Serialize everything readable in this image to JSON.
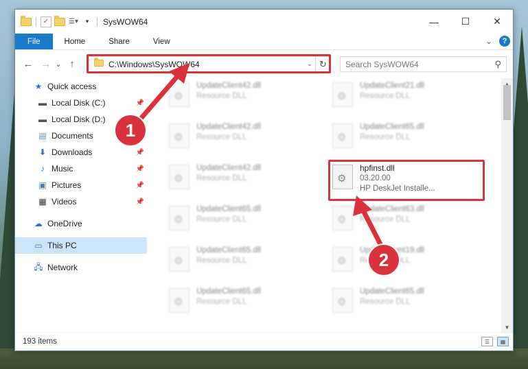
{
  "window": {
    "title": "SysWOW64",
    "minimize": "—",
    "maximize": "☐",
    "close": "✕"
  },
  "ribbon": {
    "tabs": [
      "File",
      "Home",
      "Share",
      "View"
    ],
    "collapse": "⌄",
    "help": "?"
  },
  "address": {
    "back": "←",
    "forward": "→",
    "recent": "⌄",
    "up": "↑",
    "path": "C:\\Windows\\SysWOW64",
    "dropdown": "⌄",
    "refresh": "↻"
  },
  "search": {
    "placeholder": "Search SysWOW64",
    "icon": "search-icon"
  },
  "sidebar": {
    "items": [
      {
        "label": "Quick access",
        "icon": "star-icon",
        "pinned": false
      },
      {
        "label": "Local Disk (C:)",
        "icon": "drive-icon",
        "pinned": true
      },
      {
        "label": "Local Disk (D:)",
        "icon": "drive-icon",
        "pinned": true
      },
      {
        "label": "Documents",
        "icon": "documents-icon",
        "pinned": true
      },
      {
        "label": "Downloads",
        "icon": "download-icon",
        "pinned": true
      },
      {
        "label": "Music",
        "icon": "music-icon",
        "pinned": true
      },
      {
        "label": "Pictures",
        "icon": "pictures-icon",
        "pinned": true
      },
      {
        "label": "Videos",
        "icon": "videos-icon",
        "pinned": true
      },
      {
        "label": "OneDrive",
        "icon": "cloud-icon",
        "pinned": false
      },
      {
        "label": "This PC",
        "icon": "computer-icon",
        "pinned": false,
        "selected": true
      },
      {
        "label": "Network",
        "icon": "network-icon",
        "pinned": false
      }
    ]
  },
  "files": {
    "focused": {
      "name": "hpfinst.dll",
      "version": "03.20.00",
      "description": "HP DeskJet Installe..."
    },
    "blurred": [
      {
        "name": "UpdateClient42.dll",
        "type": "Resource DLL"
      },
      {
        "name": "UpdateClient21.dll",
        "type": "Resource DLL"
      },
      {
        "name": "UpdateClient42.dll",
        "type": "Resource DLL"
      },
      {
        "name": "UpdateClient65.dll",
        "type": "Resource DLL"
      },
      {
        "name": "UpdateClient42.dll",
        "type": "Resource DLL"
      },
      {
        "name": "UpdateClient65.dll",
        "type": "Resource DLL"
      },
      {
        "name": "UpdateClient63.dll",
        "type": "Resource DLL"
      },
      {
        "name": "UpdateClient65.dll",
        "type": "Resource DLL"
      },
      {
        "name": "UpdateClient19.dll",
        "type": "Resource DLL"
      },
      {
        "name": "UpdateClient65.dll",
        "type": "Resource DLL"
      },
      {
        "name": "UpdateClient65.dll",
        "type": "Resource DLL"
      }
    ]
  },
  "status": {
    "item_count": "193 items"
  },
  "annotations": {
    "step1": "1",
    "step2": "2",
    "color": "#d9323c"
  }
}
